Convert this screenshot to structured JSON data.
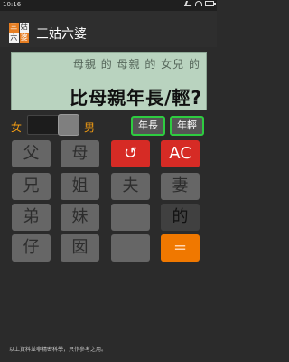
{
  "status": {
    "time": "10:16"
  },
  "app": {
    "logo_chars": [
      "三",
      "姑",
      "六",
      "婆"
    ],
    "title": "三姑六婆"
  },
  "display": {
    "relation": "母親 的 母親 的 女兒 的",
    "question": "比母親年長/輕?"
  },
  "gender": {
    "female": "女",
    "male": "男"
  },
  "age": {
    "older": "年長",
    "younger": "年輕"
  },
  "keys": {
    "row1": [
      "父",
      "母",
      "↺",
      "AC"
    ],
    "row2": [
      "兄",
      "姐",
      "夫",
      "妻"
    ],
    "row3": [
      "弟",
      "妹",
      "",
      "的"
    ],
    "row4": [
      "仔",
      "囡",
      "",
      "="
    ]
  },
  "footer": "以上資料並非精密科學，只作參考之用。"
}
